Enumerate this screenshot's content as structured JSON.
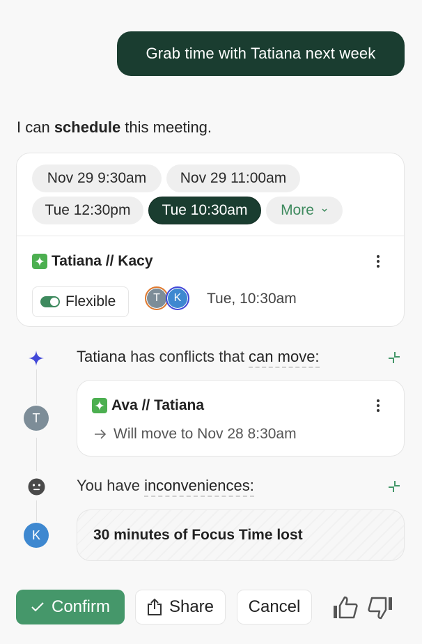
{
  "user_message": "Grab time with Tatiana next week",
  "assistant": {
    "intro_prefix": "I can ",
    "intro_bold": "schedule",
    "intro_suffix": " this meeting."
  },
  "time_options": {
    "chips": [
      {
        "label": "Nov 29 9:30am",
        "selected": false
      },
      {
        "label": "Nov 29 11:00am",
        "selected": false
      },
      {
        "label": "Tue 12:30pm",
        "selected": false
      },
      {
        "label": "Tue 10:30am",
        "selected": true
      }
    ],
    "more_label": "More"
  },
  "event": {
    "title": "Tatiana // Kacy",
    "flexible_label": "Flexible",
    "flexible_on": true,
    "attendees": [
      {
        "initial": "T",
        "name": "Tatiana"
      },
      {
        "initial": "K",
        "name": "Kacy"
      }
    ],
    "time": "Tue, 10:30am"
  },
  "conflicts": {
    "person": "Tatiana",
    "text_middle": " has conflicts that ",
    "text_underlined": "can move:",
    "avatar_initial": "T",
    "items": [
      {
        "title": "Ava // Tatiana",
        "move_text": "Will move to Nov 28 8:30am"
      }
    ]
  },
  "inconveniences": {
    "text_prefix": "You have ",
    "text_underlined": "inconveniences:",
    "avatar_initial": "K",
    "items": [
      {
        "text": "30 minutes of Focus Time lost"
      }
    ]
  },
  "actions": {
    "confirm_label": "Confirm",
    "share_label": "Share",
    "cancel_label": "Cancel"
  },
  "colors": {
    "brand_dark": "#1a3d30",
    "accent_green": "#45976a",
    "sparkle_blue": "#4248d8",
    "avatar_t": "#7d8d98",
    "avatar_k": "#3e88d0"
  }
}
